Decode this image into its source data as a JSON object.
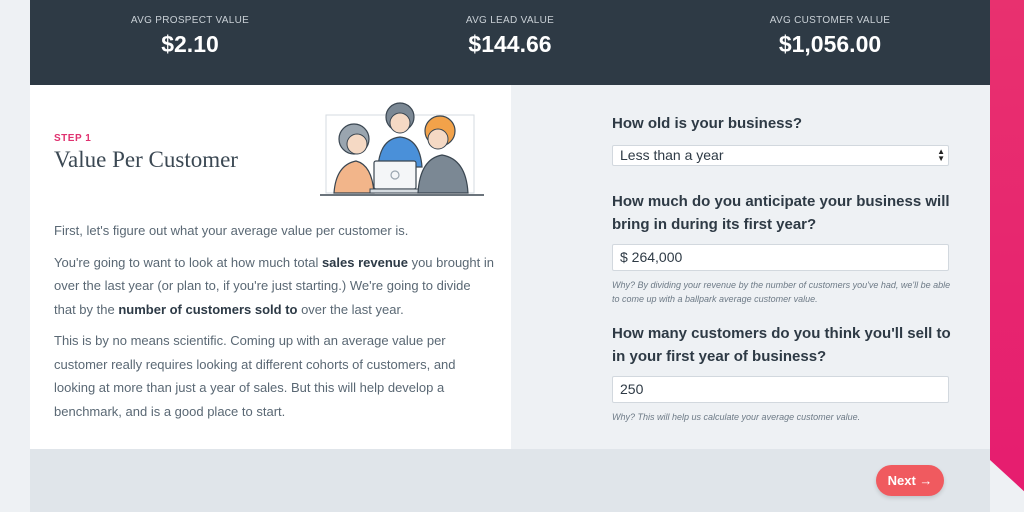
{
  "stats": [
    {
      "label": "AVG PROSPECT VALUE",
      "value": "$2.10"
    },
    {
      "label": "AVG LEAD VALUE",
      "value": "$144.66"
    },
    {
      "label": "AVG CUSTOMER VALUE",
      "value": "$1,056.00"
    }
  ],
  "step": {
    "label": "STEP 1",
    "title": "Value Per Customer"
  },
  "copy": {
    "p1": "First, let's figure out what your average value per customer is.",
    "p2_a": "You're going to want to look at how much total ",
    "p2_b": "sales revenue",
    "p2_c": " you brought in over the last year (or plan to, if you're just starting.) We're going to divide that by the ",
    "p2_d": "number of customers sold to",
    "p2_e": " over the last year.",
    "p3": "This is by no means scientific. Coming up with an average value per customer really requires looking at different cohorts of customers, and looking at more than just a year of sales. But this will help develop a benchmark, and is a good place to start."
  },
  "form": {
    "q1": "How old is your business?",
    "q1_value": "Less than a year",
    "q2": "How much do you anticipate your business will bring in during its first year?",
    "q2_value": "$ 264,000",
    "q2_hint": "Why? By dividing your revenue by the number of customers you've had, we'll be able to come up with a ballpark average customer value.",
    "q3": "How many customers do you think you'll sell to in your first year of business?",
    "q3_value": "250",
    "q3_hint": "Why? This will help us calculate your average customer value."
  },
  "next_label": "Next →",
  "colors": {
    "accent": "#e0316f",
    "header_bg": "#2e3a45",
    "button": "#f05a5f"
  }
}
